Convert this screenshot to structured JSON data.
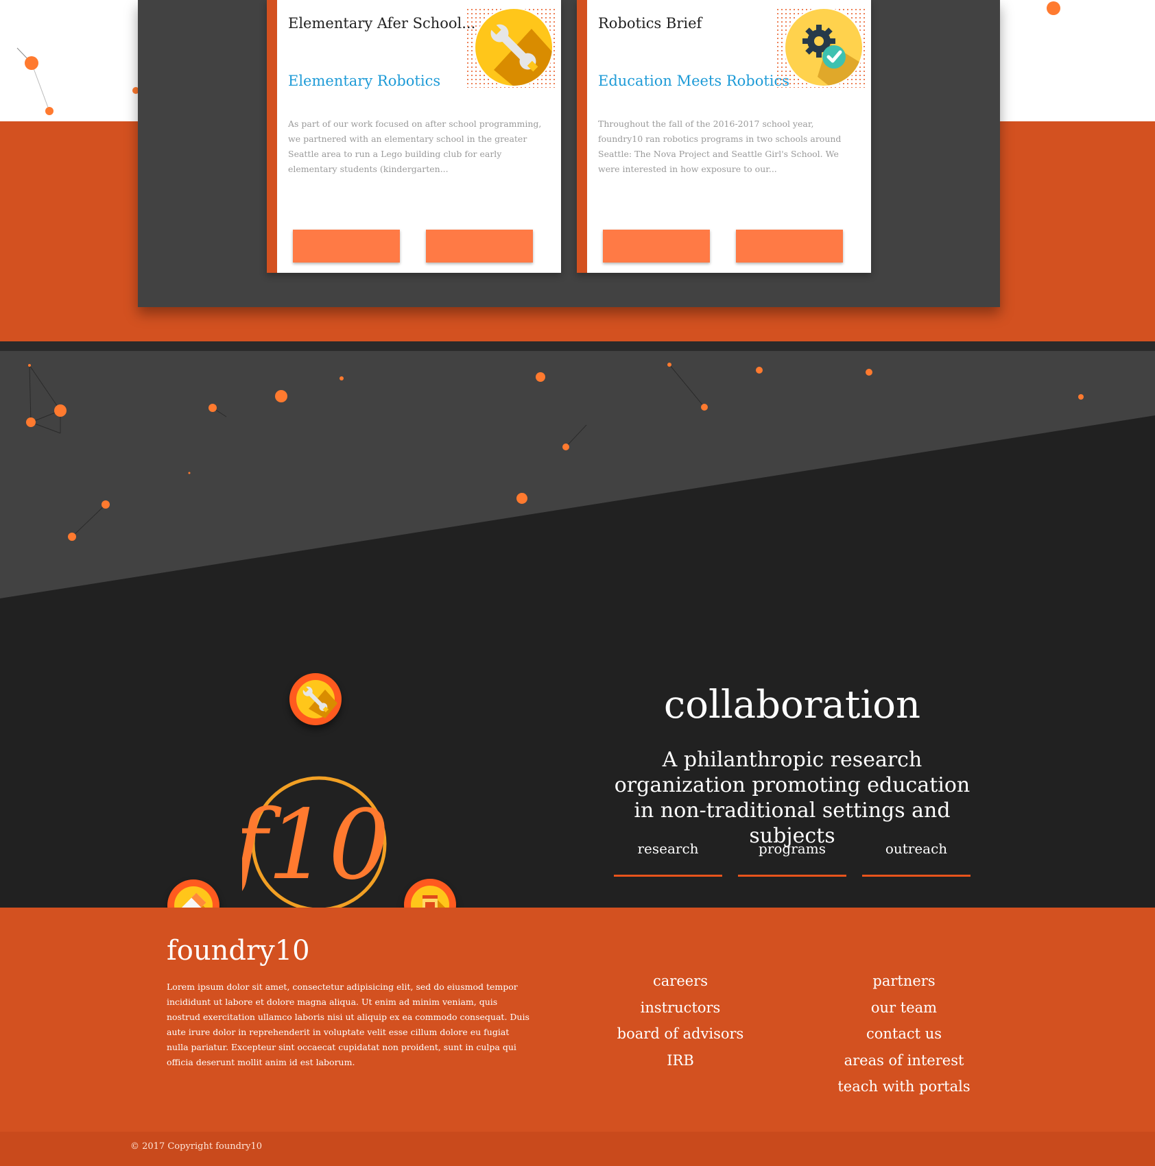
{
  "colors": {
    "orange": "#d35120",
    "button": "#ff7a45",
    "accent_blue": "#1e9bd7",
    "dark": "#212121",
    "panel": "#424242"
  },
  "cards": [
    {
      "title": "Elementary Afer School...",
      "subtitle": "Elementary Robotics",
      "body": "As part of our work focused on after school programming, we partnered with an elementary school in the greater Seattle area to run a Lego building club for early elementary students (kindergarten...",
      "icon": "wrench-icon"
    },
    {
      "title": "Robotics Brief",
      "subtitle": "Education Meets Robotics",
      "body": "Throughout the fall of the 2016-2017 school year, foundry10 ran robotics programs in two schools around Seattle: The Nova Project and Seattle Girl's School. We were interested in how exposure to our...",
      "icon": "gear-check-icon"
    }
  ],
  "hero": {
    "logo": "f10",
    "title": "collaboration",
    "tagline": "A philanthropic research organization promoting education in non-traditional settings and subjects",
    "links": [
      "research",
      "programs",
      "outreach"
    ],
    "icons": [
      "wrench-icon",
      "eraser-icon",
      "jar-icon"
    ]
  },
  "footer": {
    "brand": "foundry10",
    "body": "Lorem ipsum dolor sit amet, consectetur adipisicing elit, sed do eiusmod tempor incididunt ut labore et dolore magna aliqua. Ut enim ad minim veniam, quis nostrud exercitation ullamco laboris nisi ut aliquip ex ea commodo consequat. Duis aute irure dolor in reprehenderit in voluptate velit esse cillum dolore eu fugiat nulla pariatur. Excepteur sint occaecat cupidatat non proident, sunt in culpa qui officia deserunt mollit anim id est laborum.",
    "col1": [
      "careers",
      "instructors",
      "board of advisors",
      "IRB"
    ],
    "col2": [
      "partners",
      "our team",
      "contact us",
      "areas of interest",
      "teach with portals"
    ],
    "copyright": "© 2017 Copyright foundry10"
  }
}
